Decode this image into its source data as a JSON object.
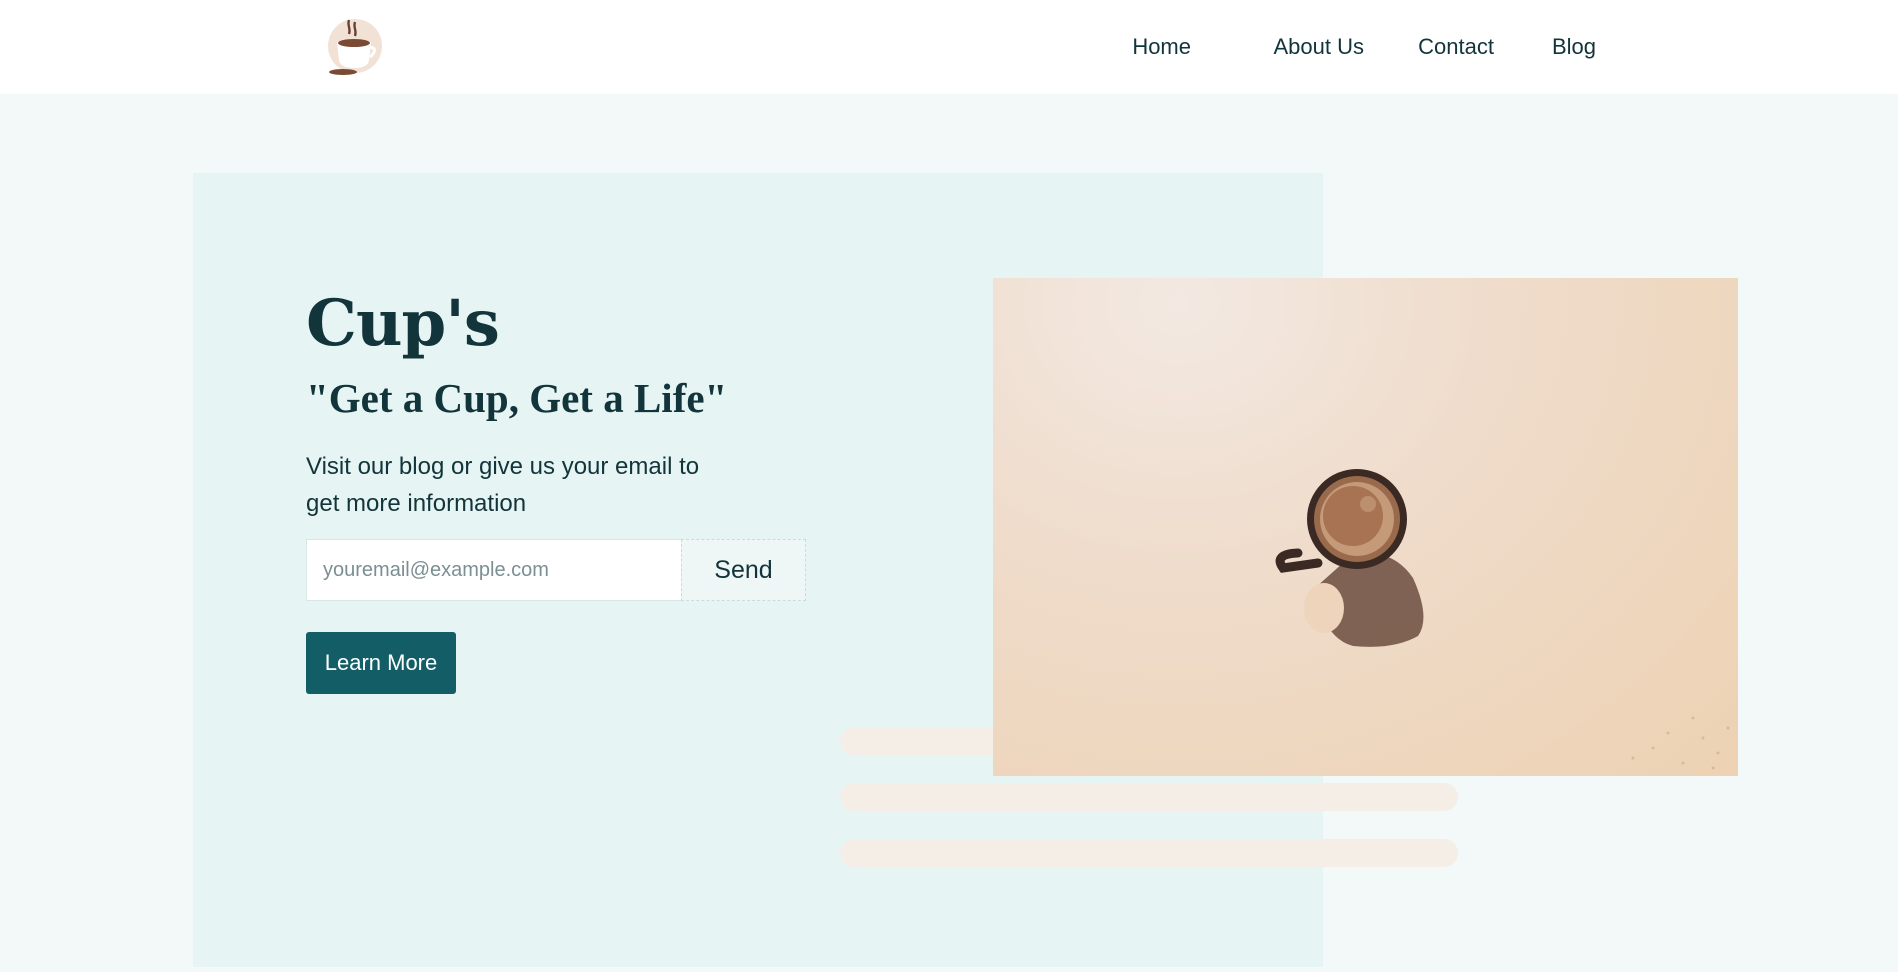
{
  "header": {
    "logo_icon": "coffee-cup-logo-icon",
    "nav": [
      {
        "label": "Home"
      },
      {
        "label": "About Us"
      },
      {
        "label": "Contact"
      },
      {
        "label": "Blog"
      }
    ]
  },
  "hero": {
    "title": "Cup's",
    "tagline": "\"Get a Cup, Get a Life\"",
    "description": "Visit our blog or give us your email to get more information",
    "email_placeholder": "youremail@example.com",
    "send_label": "Send",
    "learn_more_label": "Learn More",
    "image_icon": "coffee-mug-photo"
  },
  "colors": {
    "primary": "#135e66",
    "text": "#12343b",
    "panel": "#e6f5f4",
    "page_bg": "#f3f8f8",
    "bar": "#f5eee6"
  }
}
